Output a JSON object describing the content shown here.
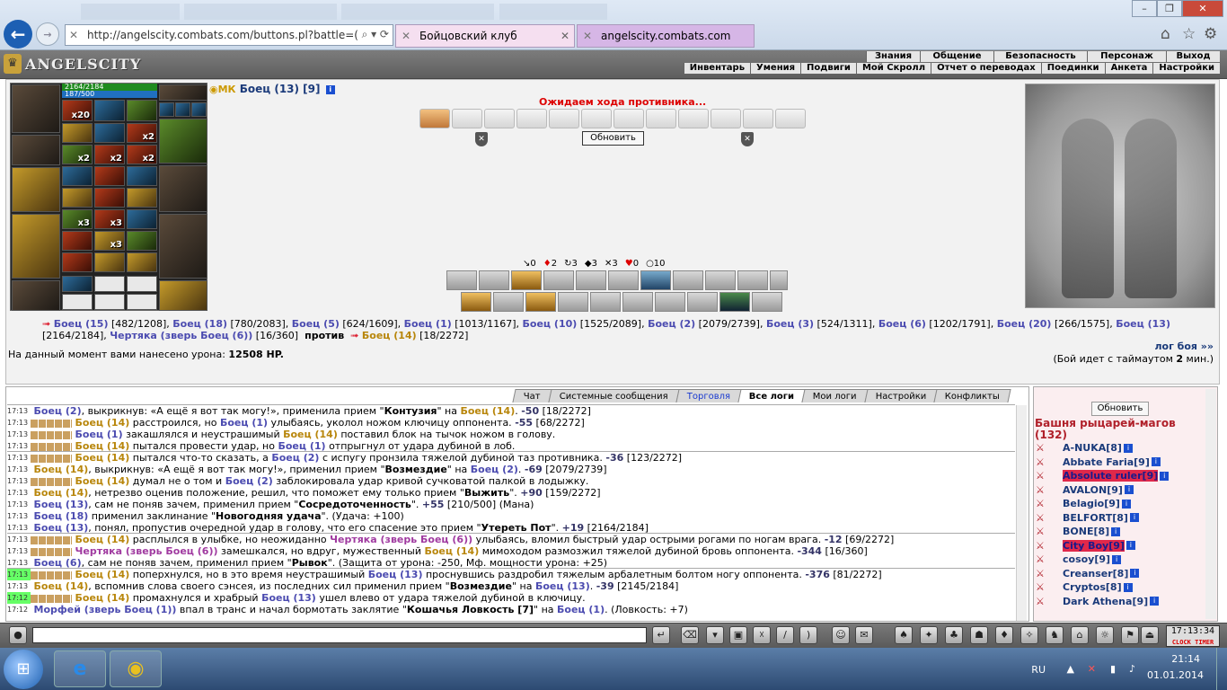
{
  "browser": {
    "url": "http://angelscity.combats.com/buttons.pl?battle=(",
    "tabs": [
      {
        "label": "Бойцовский клуб"
      },
      {
        "label": "angelscity.combats.com"
      }
    ]
  },
  "game": {
    "logo": "ANGELSCITY",
    "menu_top": [
      "Знания",
      "Общение",
      "Безопасность",
      "Персонаж",
      "Выход"
    ],
    "menu_bottom": [
      "Инвентарь",
      "Умения",
      "Подвиги",
      "Мой Скролл",
      "Отчет о переводах",
      "Поединки",
      "Анкета",
      "Настройки"
    ],
    "hp": "2164/2184",
    "mp": "187/500",
    "char_name": "Боец (13) [9]",
    "waiting_text": "Ожидаем хода противника...",
    "refresh_label": "Обновить",
    "stats": [
      "0",
      "2",
      "3",
      "3",
      "3",
      "0",
      "10"
    ],
    "counts": [
      "x20",
      "x2",
      "x2",
      "x2",
      "x2",
      "x3",
      "x3",
      "x3"
    ],
    "vs": {
      "team1": [
        {
          "name": "Боец (15)",
          "hp": "[482/1208]"
        },
        {
          "name": "Боец (18)",
          "hp": "[780/2083]"
        },
        {
          "name": "Боец (5)",
          "hp": "[624/1609]"
        },
        {
          "name": "Боец (1)",
          "hp": "[1013/1167]"
        },
        {
          "name": "Боец (10)",
          "hp": "[1525/2089]"
        },
        {
          "name": "Боец (2)",
          "hp": "[2079/2739]"
        },
        {
          "name": "Боец (3)",
          "hp": "[524/1311]"
        },
        {
          "name": "Боец (6)",
          "hp": "[1202/1791]"
        },
        {
          "name": "Боец (20)",
          "hp": "[266/1575]"
        },
        {
          "name": "Боец (13)",
          "hp": "[2164/2184]"
        },
        {
          "name": "Чертяка (зверь Боец (6))",
          "hp": "[16/360]"
        }
      ],
      "versus_label": "против",
      "team2": [
        {
          "name": "Боец (14)",
          "hp": "[18/2272]"
        }
      ]
    },
    "damage_prefix": "На данный момент вами нанесено урона: ",
    "damage_value": "12508 HP.",
    "log_link": "лог боя »»",
    "timeout_prefix": "(Бой идет с таймаутом ",
    "timeout_value": "2",
    "timeout_suffix": " мин.)"
  },
  "chat": {
    "tabs": [
      "Чат",
      "Системные сообщения",
      "Торговля",
      "Все логи",
      "Мои логи",
      "Настройки",
      "Конфликты"
    ],
    "active_tab": "Все логи",
    "lines": [
      {
        "t": "17:13",
        "sq": false,
        "html": "<span class='nm2'>Боец (2)</span>, выкрикнув: «А ещё я вот так могу!», применила прием \"<b>Контузия</b>\" на <span class='me2'>Боец (14)</span>. <span class='neg'>-50</span> [18/2272]"
      },
      {
        "t": "17:13",
        "sq": true,
        "html": "<span class='me2'>Боец (14)</span> расстроился, но <span class='nm2'>Боец (1)</span> улыбаясь, уколол ножом ключицу оппонента. <span class='neg'>-55</span> [68/2272]"
      },
      {
        "t": "17:13",
        "sq": true,
        "html": "<span class='nm2'>Боец (1)</span> закашлялся и неустрашимый <span class='me2'>Боец (14)</span> поставил блок на тычок ножом в голову."
      },
      {
        "t": "17:13",
        "sq": true,
        "html": "<span class='me2'>Боец (14)</span> пытался провести удар, но <span class='nm2'>Боец (1)</span> отпрыгнул от удара дубиной в лоб.",
        "sep": true
      },
      {
        "t": "17:13",
        "sq": true,
        "html": "<span class='me2'>Боец (14)</span> пытался что-то сказать, а <span class='nm2'>Боец (2)</span> с испугу пронзила тяжелой дубиной таз противника. <span class='neg'>-36</span> [123/2272]"
      },
      {
        "t": "17:13",
        "sq": false,
        "html": "<span class='me2'>Боец (14)</span>, выкрикнув: «А ещё я вот так могу!», применил прием \"<b>Возмездие</b>\" на <span class='nm2'>Боец (2)</span>. <span class='neg'>-69</span> [2079/2739]"
      },
      {
        "t": "17:13",
        "sq": true,
        "html": "<span class='me2'>Боец (14)</span> думал не о том и <span class='nm2'>Боец (2)</span> заблокировала удар кривой сучковатой палкой в лодыжку."
      },
      {
        "t": "17:13",
        "sq": false,
        "html": "<span class='me2'>Боец (14)</span>, нетрезво оценив положение, решил, что поможет ему только прием \"<b>Выжить</b>\". <span class='neg'>+90</span> [159/2272]"
      },
      {
        "t": "17:13",
        "sq": false,
        "html": "<span class='nm2'>Боец (13)</span>, сам не поняв зачем, применил прием \"<b>Сосредоточенность</b>\". <span class='neg'>+55</span> [210/500] (Мана)"
      },
      {
        "t": "17:13",
        "sq": false,
        "html": "<span class='nm2'>Боец (18)</span> применил заклинание \"<b>Новогодняя удача</b>\". (Удача: +100)"
      },
      {
        "t": "17:13",
        "sq": false,
        "html": "<span class='nm2'>Боец (13)</span>, понял, пропустив очередной удар в голову, что его спасение это прием \"<b>Утереть Пот</b>\". <span class='neg'>+19</span> [2164/2184]",
        "sep": true
      },
      {
        "t": "17:13",
        "sq": true,
        "html": "<span class='me2'>Боец (14)</span> расплылся в улыбке, но неожиданно <span class='pet'>Чертяка (зверь Боец (6))</span> улыбаясь, вломил быстрый удар острыми рогами по ногам врага. <span class='neg'>-12</span> [69/2272]"
      },
      {
        "t": "17:13",
        "sq": true,
        "html": "<span class='pet'>Чертяка (зверь Боец (6))</span> замешкался, но вдруг, мужественный <span class='me2'>Боец (14)</span> мимоходом размозжил тяжелой дубиной бровь оппонента. <span class='neg'>-344</span> [16/360]"
      },
      {
        "t": "17:13",
        "sq": false,
        "html": "<span class='nm2'>Боец (6)</span>, сам не поняв зачем, применил прием \"<b>Рывок</b>\". (Защита от урона: -250, Мф. мощности урона: +25)",
        "sep": true
      },
      {
        "t": "17:13",
        "sq": true,
        "g": true,
        "html": "<span class='me2'>Боец (14)</span> поперхнулся, но в это время неустрашимый <span class='nm2'>Боец (13)</span> проснувшись раздробил тяжелым арбалетным болтом ногу оппонента. <span class='neg'>-376</span> [81/2272]"
      },
      {
        "t": "17:13",
        "sq": false,
        "html": "<span class='me2'>Боец (14)</span>, вспомнив слова своего сэнсея, из последних сил применил прием \"<b>Возмездие</b>\" на <span class='nm2'>Боец (13)</span>. <span class='neg'>-39</span> [2145/2184]"
      },
      {
        "t": "17:12",
        "sq": true,
        "g": true,
        "html": "<span class='me2'>Боец (14)</span> промахнулся и храбрый <span class='nm2'>Боец (13)</span> ушел влево от удара тяжелой дубиной в ключицу."
      },
      {
        "t": "17:12",
        "sq": false,
        "html": "<span class='nm2'>Морфей (зверь Боец (1))</span> впал в транс и начал бормотать заклятие \"<b>Кошачья Ловкость [7]</b>\" на <span class='nm2'>Боец (1)</span>. (Ловкость: +7)"
      }
    ]
  },
  "who": {
    "refresh_label": "Обновить",
    "title": "Башня рыцарей-магов (132)",
    "users": [
      {
        "name": "A-NUKA[8]",
        "hl": false
      },
      {
        "name": "Abbate Faria[9]",
        "hl": false
      },
      {
        "name": "Absolute ruler[9]",
        "hl": true
      },
      {
        "name": "AVALON[9]",
        "hl": false
      },
      {
        "name": "Belagio[9]",
        "hl": false
      },
      {
        "name": "BELFORT[8]",
        "hl": false
      },
      {
        "name": "BONE[8]",
        "hl": false
      },
      {
        "name": "City Boy[9]",
        "hl": true
      },
      {
        "name": "cosoy[9]",
        "hl": false
      },
      {
        "name": "Creanser[8]",
        "hl": false
      },
      {
        "name": "Cryptos[8]",
        "hl": false
      },
      {
        "name": "Dark Athena[9]",
        "hl": false
      }
    ]
  },
  "clock": {
    "time": "17:13:34",
    "labels": [
      "CLOCK",
      "TIMER"
    ]
  },
  "taskbar": {
    "lang": "RU",
    "time": "21:14",
    "date": "01.01.2014"
  }
}
